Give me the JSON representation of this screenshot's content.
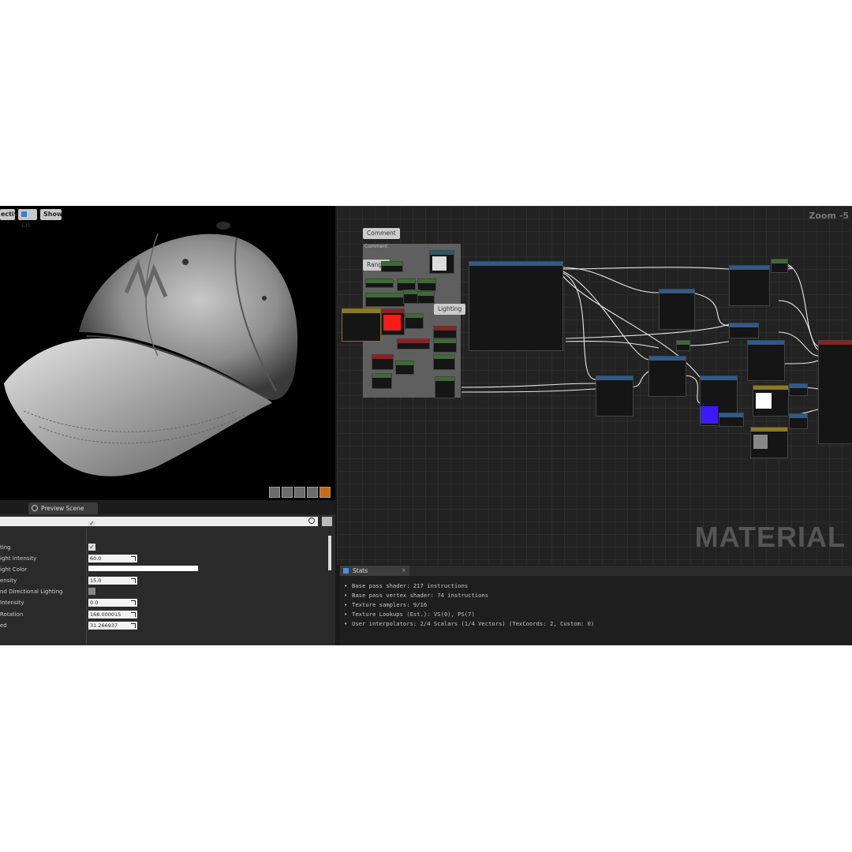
{
  "viewport": {
    "buttons": {
      "perspective": "ective",
      "lit": "Lit",
      "show": "Show"
    },
    "model_alt": "baseball cap model"
  },
  "details": {
    "tab_label": "Preview Scene Sett",
    "properties": [
      {
        "label": "",
        "type": "check",
        "value": "✓"
      },
      {
        "label": "ting",
        "type": "check",
        "value": "✓"
      },
      {
        "label": "ight Intensity",
        "type": "number",
        "value": "60.0"
      },
      {
        "label": "ight Color",
        "type": "color",
        "value": "#ffffff"
      },
      {
        "label": "ensity",
        "type": "number",
        "value": "15.0"
      },
      {
        "label": "nd Directional Lighting",
        "type": "check-off",
        "value": ""
      },
      {
        "label": "Intensity",
        "type": "number",
        "value": "0.0"
      },
      {
        "label": "Rotation",
        "type": "number",
        "value": "168.000015"
      },
      {
        "label": "ed",
        "type": "number",
        "value": "31.266937"
      }
    ]
  },
  "graph": {
    "zoom_label": "Zoom -5",
    "watermark": "MATERIAL",
    "bubbles": [
      "Comment",
      "Range",
      "Lighting"
    ],
    "comment_group_title": "Comment"
  },
  "stats": {
    "tab_label": "Stats",
    "close": "×",
    "lines": [
      "Base pass shader: 217 instructions",
      "Base pass vertex shader: 74 instructions",
      "Texture samplers: 9/16",
      "Texture Lookups (Est.): VS(0), PS(7)",
      "User interpolators: 2/4 Scalars (1/4 Vectors) (TexCoords: 2, Custom: 0)"
    ]
  },
  "colors": {
    "accent_red": "#ff1a1a",
    "accent_blue": "#3c1aff",
    "graph_bg": "#222222"
  }
}
